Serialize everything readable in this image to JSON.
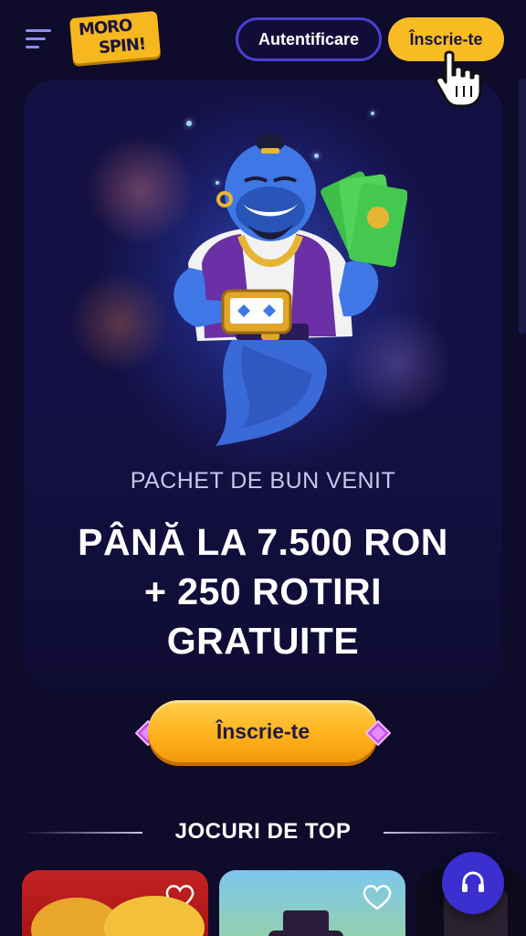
{
  "header": {
    "menu_icon": "hamburger-menu-icon",
    "logo": {
      "line1": "MORO",
      "line2": "SPIN!"
    },
    "login_label": "Autentificare",
    "signup_label": "Înscrie-te",
    "cursor_icon": "hand-pointer-icon"
  },
  "hero": {
    "subtitle": "PACHET DE BUN VENIT",
    "headline_lines": [
      "PÂNĂ LA 7.500 RON",
      "+ 250 ROTIRI",
      "GRATUITE"
    ],
    "cta_label": "Înscrie-te",
    "illustration": "genie-with-money-icon"
  },
  "top_games": {
    "title": "JOCURI DE TOP",
    "cards": [
      {
        "favorite_icon": "heart-icon"
      },
      {
        "favorite_icon": "heart-icon"
      },
      {
        "favorite_icon": ""
      }
    ]
  },
  "support": {
    "icon": "headset-icon"
  },
  "colors": {
    "background": "#0e0b2b",
    "accent_yellow": "#f9bc24",
    "accent_purple": "#4b3fd3",
    "hero_card": "#141043"
  }
}
